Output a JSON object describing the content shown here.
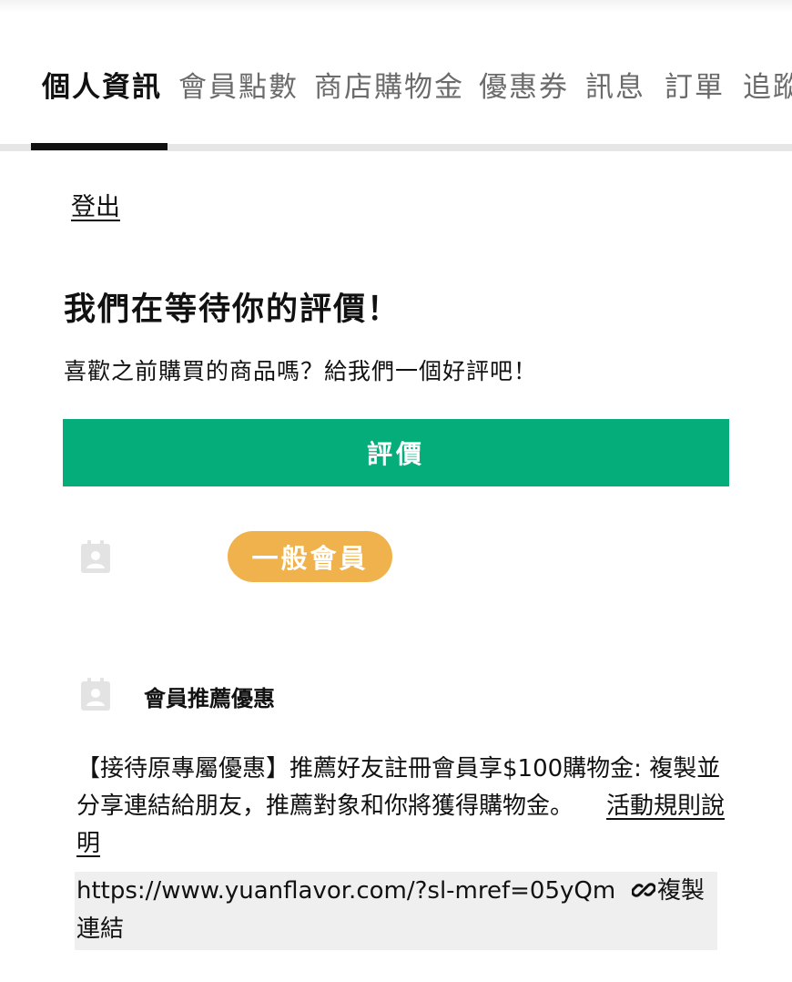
{
  "tabs": [
    {
      "label": "個人資訊",
      "active": true
    },
    {
      "label": "會員點數",
      "active": false
    },
    {
      "label": "商店購物金",
      "active": false
    },
    {
      "label": "優惠券",
      "active": false
    },
    {
      "label": "訊息",
      "active": false
    },
    {
      "label": "訂單",
      "active": false
    },
    {
      "label": "追蹤",
      "active": false
    }
  ],
  "account": {
    "logout_label": "登出"
  },
  "review": {
    "title": "我們在等待你的評價！",
    "subtitle": "喜歡之前購買的商品嗎？給我們一個好評吧！",
    "button_label": "評價"
  },
  "member": {
    "tier_label": "一般會員"
  },
  "referral": {
    "title": "會員推薦優惠",
    "description": "【接待原專屬優惠】推薦好友註冊會員享$100購物金: 複製並分享連結給朋友，推薦對象和你將獲得購物金。",
    "rules_link_label": "活動規則說明",
    "url": "https://www.yuanflavor.com/?sl-mref=05yQm",
    "copy_label_line1": "複製",
    "copy_label_line2": "連結"
  },
  "colors": {
    "accent_green": "#05ad7b",
    "tier_badge": "#f0b24c",
    "text": "#111111",
    "tab_inactive": "#6b6b6b",
    "link_box_bg": "#efefef"
  }
}
